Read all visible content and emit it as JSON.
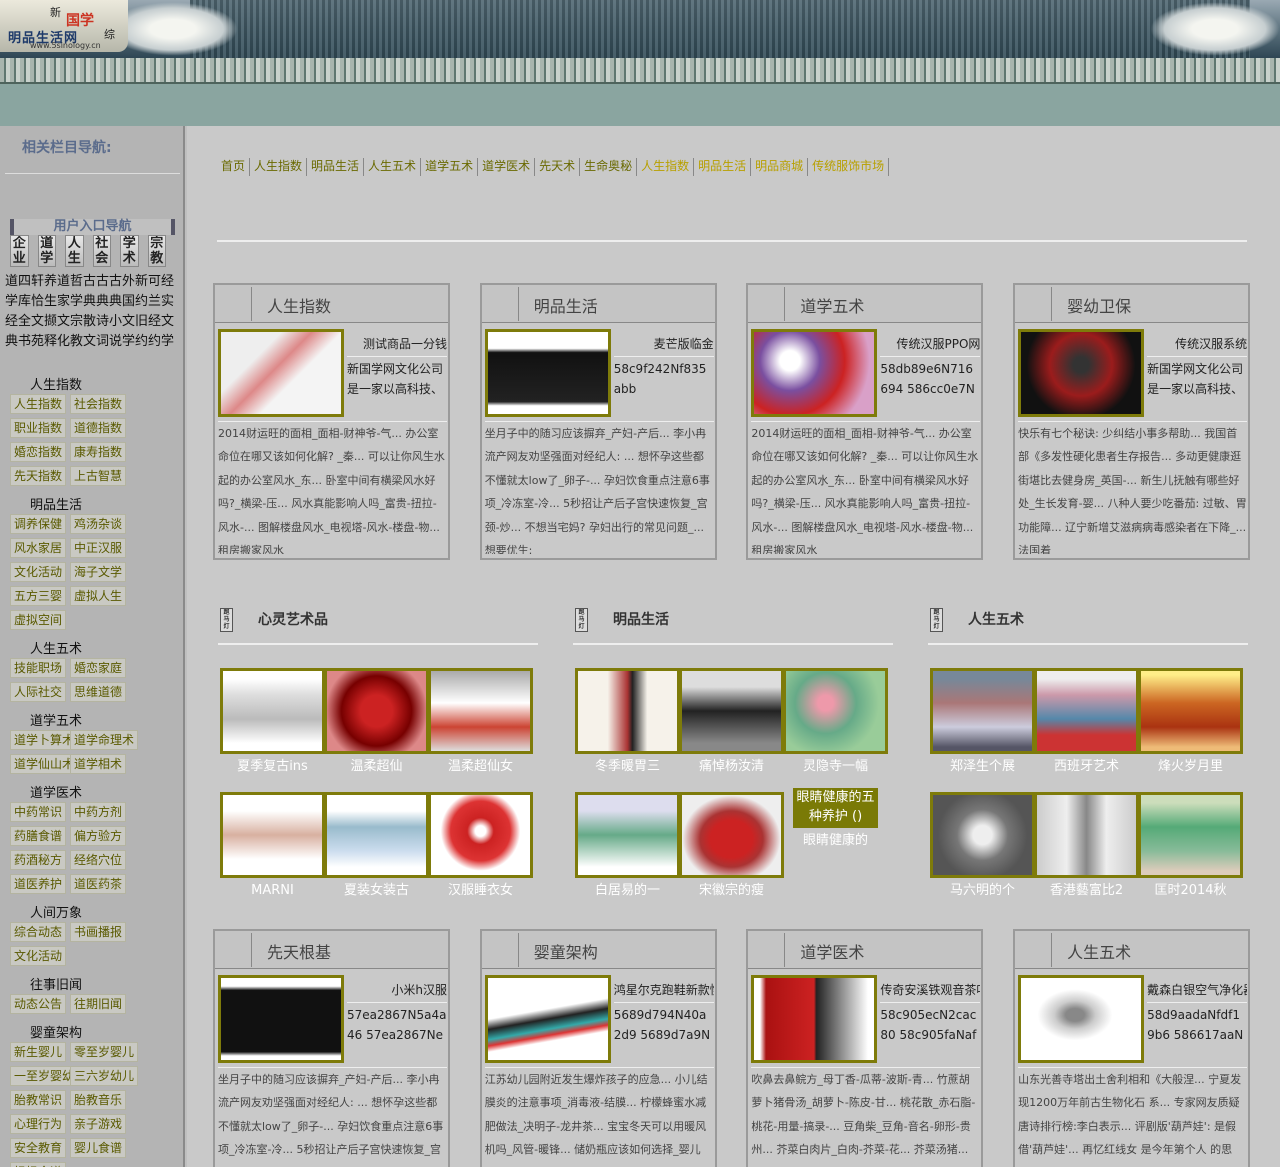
{
  "header": {
    "logo_top": "新",
    "logo_guoxue": "国学",
    "logo_main": "明品生活网",
    "logo_side": "综",
    "logo_url": "www.5sinology.cn"
  },
  "sidebar": {
    "nav_title": "相关栏目导航:",
    "user_nav_title": "用户入口导航",
    "user_icons": [
      "企业",
      "道学",
      "人生",
      "社会",
      "学术",
      "宗教"
    ],
    "word_rows": [
      "道四轩养道哲古古古外新可经",
      "学库恰生家学典典典国约兰实",
      "经全文撷文宗散诗小文旧经文",
      "典书苑释化教文词说学约约学"
    ],
    "categories": [
      {
        "name": "人生指数",
        "links": [
          [
            "人生指数",
            "社会指数"
          ],
          [
            "职业指数",
            "道德指数"
          ],
          [
            "婚恋指数",
            "康寿指数"
          ],
          [
            "先天指数",
            "上古智慧"
          ]
        ]
      },
      {
        "name": "明品生活",
        "links": [
          [
            "调养保健",
            "鸡汤杂谈"
          ],
          [
            "风水家居",
            "中正汉服"
          ],
          [
            "文化活动",
            "海子文学"
          ],
          [
            "五方三婴",
            "虚拟人生"
          ],
          [
            "虚拟空间"
          ]
        ]
      },
      {
        "name": "人生五术",
        "links": [
          [
            "技能职场",
            "婚恋家庭"
          ],
          [
            "人际社交",
            "思维道德"
          ]
        ]
      },
      {
        "name": "道学五术",
        "links": [
          [
            "道学卜算术",
            "道学命理术"
          ],
          [
            "道学仙山术",
            "道学相术"
          ]
        ]
      },
      {
        "name": "道学医术",
        "links": [
          [
            "中药常识",
            "中药方剂"
          ],
          [
            "药膳食谱",
            "偏方验方"
          ],
          [
            "药酒秘方",
            "经络穴位"
          ],
          [
            "道医养护",
            "道医药茶"
          ]
        ]
      },
      {
        "name": "人间万象",
        "links": [
          [
            "综合动态",
            "书画播报"
          ],
          [
            "文化活动"
          ]
        ]
      },
      {
        "name": "往事旧闻",
        "links": [
          [
            "动态公告",
            "往期旧闻"
          ]
        ]
      },
      {
        "name": "婴童架构",
        "links": [
          [
            "新生婴儿",
            "零至岁婴儿"
          ],
          [
            "一至岁婴幼",
            "三六岁幼儿"
          ],
          [
            "胎教常识",
            "胎教音乐"
          ],
          [
            "心理行为",
            "亲子游戏"
          ],
          [
            "安全教育",
            "婴儿食谱"
          ],
          [
            "妈妈食谱"
          ]
        ]
      },
      {
        "name": "生命奥秘",
        "links": []
      }
    ]
  },
  "topnav": [
    {
      "label": "首页",
      "hl": false
    },
    {
      "label": "人生指数",
      "hl": false
    },
    {
      "label": "明品生活",
      "hl": false
    },
    {
      "label": "人生五术",
      "hl": false
    },
    {
      "label": "道学五术",
      "hl": false
    },
    {
      "label": "道学医术",
      "hl": false
    },
    {
      "label": "先天术",
      "hl": false
    },
    {
      "label": "生命奥秘",
      "hl": false
    },
    {
      "label": "人生指数",
      "hl": true
    },
    {
      "label": "明品生活",
      "hl": true
    },
    {
      "label": "明品商城",
      "hl": true
    },
    {
      "label": "传统服饰市场",
      "hl": true
    }
  ],
  "panels_row1": [
    {
      "title": "人生指数",
      "name": "测试商品一分钱",
      "desc": "新国学网文化公司是一家以高科技、",
      "list": "2014财运旺的面相_面相-财神爷-气... 办公室命位在哪又该如何化解? _秦... 可以让你风生水起的办公室风水_东... 卧室中间有横梁风水好吗?_横梁-压... 风水真能影响人吗_富贵-扭拉-风水-... 图解楼盘风水_电视塔-风水-楼盘-物... 租房搬家风水"
    },
    {
      "title": "明品生活",
      "name": "麦芒版临金",
      "desc": "58c9f242Nf835abb",
      "list": "坐月子中的随习应该摒弃_产妇-产后... 李小冉流产网友劝坚强面对经纪人: ... 想怀孕这些都不懂就太low了_卵子-... 孕妇饮食重点注意6事项_冷冻室-冷... 5秒招让产后子宫快速恢复_宫颈-炒... 不想当宅妈? 孕妇出行的常见问题_... 想要优生:"
    },
    {
      "title": "道学五术",
      "name": "传统汉服PPO网",
      "desc": "58db89e6N716694 586cc0e7N4c95ae",
      "list": "2014财运旺的面相_面相-财神爷-气... 办公室命位在哪又该如何化解? _秦... 可以让你风生水起的办公室风水_东... 卧室中间有横梁风水好吗?_横梁-压... 风水真能影响人吗_富贵-扭拉-风水-... 图解楼盘风水_电视塔-风水-楼盘-物... 租房搬家风水"
    },
    {
      "title": "婴幼卫保",
      "name": "传统汉服系统",
      "desc": "新国学网文化公司是一家以高科技、高文",
      "list": "快乐有七个秘诀: 少纠结小事多帮助... 我国首部《多发性硬化患者生存报告... 多动更健康逛街堪比去健身房_英国-... 新生儿抚触有哪些好处_生长发育-婴... 八种人要少吃番茄: 过敏、胃功能障... 辽宁新增艾滋病病毒感染者在下降_... 法国着"
    }
  ],
  "sections": [
    {
      "title": "心灵艺术品",
      "icon": "跑马灯",
      "items": [
        [
          "夏季复古ins"
        ],
        [
          "温柔超仙"
        ],
        [
          "温柔超仙女"
        ],
        [
          "MARNI"
        ],
        [
          "夏装女装古"
        ],
        [
          "汉服睡衣女"
        ]
      ]
    },
    {
      "title": "明品生活",
      "icon": "跑马灯",
      "items": [
        [
          "冬季暖胃三"
        ],
        [
          "痛悼杨汝清"
        ],
        [
          "灵隐寺一幅"
        ],
        [
          "白居易的一"
        ],
        [
          "宋徽宗的瘦"
        ],
        [
          "眼睛健康的"
        ]
      ],
      "hover": "眼睛健康的五种养护 ()"
    },
    {
      "title": "人生五术",
      "icon": "跑马灯",
      "items": [
        [
          "郑泽生个展"
        ],
        [
          "西班牙艺术"
        ],
        [
          "烽火岁月里"
        ],
        [
          "马六明的个"
        ],
        [
          "香港藝富比2"
        ],
        [
          "匡时2014秋"
        ]
      ]
    }
  ],
  "panels_row2": [
    {
      "title": "先天根基",
      "name": "小米h汉服",
      "desc": "57ea2867N5a4a46 57ea2867Nedffe8e",
      "list": "坐月子中的随习应该摒弃_产妇-产后... 李小冉流产网友劝坚强面对经纪人: ... 想怀孕这些都不懂就太low了_卵子-... 孕妇饮食重点注意6事项_冷冻室-冷... 5秒招让产后子宫快速恢复_宫颈-炒... 不想当宅"
    },
    {
      "title": "婴童架构",
      "name": "鸿星尔克跑鞋新款慢",
      "desc": "5689d794N40a2d9 5689d7a9Nd2d48f",
      "list": "江苏幼儿园附近发生爆炸孩子的应急... 小儿结膜炎的注意事项_消毒液-结膜... 柠檬蜂蜜水减肥做法_决明子-龙井茶... 宝宝冬天可以用暖风机吗_风管-暖锋... 储奶瓶应该如何选择_婴儿的... 冷藏保"
    },
    {
      "title": "道学医术",
      "name": "传奇安溪铁观音茶叶",
      "desc": "58c905ecN2cac80 58c905faNaf15792",
      "list": "吹鼻去鼻鲩方_母丁香-瓜蒂-波斯-青... 竹蔗胡萝卜猪骨汤_胡萝卜-陈皮-甘... 桃花散_赤石脂-桃花-用量-搞录-... 豆角柴_豆角-音名-卵形-贵州... 芥菜白肉片_白肉-芥菜-花... 芥菜汤猪... 黄柏"
    },
    {
      "title": "人生五术",
      "name": "戴森白银空气净化器",
      "desc": "58d9aadaNfdf19b6 586617aaN888b29",
      "list": "山东光善寺塔出土舍利相和《大般涅... 宁夏发现1200万年前古生物化石 系... 专家网友质疑唐诗排行榜:李白表示... 评剧版'葫芦娃': 是假借'葫芦娃'... 再忆红线女 是今年第个人 的思想..."
    }
  ]
}
